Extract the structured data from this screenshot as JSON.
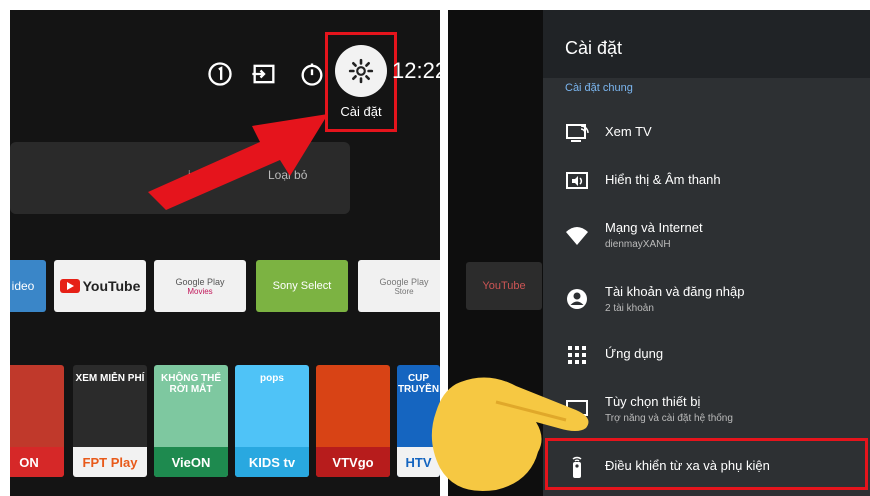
{
  "left_panel": {
    "clock": "12:22",
    "settings_label": "Cài đặt",
    "card": {
      "details_label": "i tiết",
      "remove_label": "Loại bỏ"
    },
    "apps": [
      {
        "label": "ideo",
        "bg": "#3a86c8",
        "fg": "#ffffff"
      },
      {
        "label": "YouTube",
        "bg": "#f1f1f1",
        "fg": "#222222"
      },
      {
        "label": "Google Play",
        "sub": "Movies",
        "bg": "#f1f1f1",
        "fg": "#555555"
      },
      {
        "label": "Sony Select",
        "bg": "#7cb342",
        "fg": "#ffffff"
      },
      {
        "label": "Google Play",
        "sub": "Store",
        "bg": "#f1f1f1",
        "fg": "#777777"
      }
    ],
    "tiles": [
      {
        "top_text": "",
        "bottom_text": "ON",
        "bg": "#c0392b",
        "bottom_bg": "#d62828",
        "fg": "#ffffff"
      },
      {
        "top_text": "XEM MIỄN PHÍ",
        "bottom_text": "FPT Play",
        "bg": "#2b2b2b",
        "bottom_bg": "#f2f2f2",
        "fg": "#e85a1a"
      },
      {
        "top_text": "KHÔNG THỂ RỜI MẮT",
        "bottom_text": "VieON",
        "bg": "#7ec8a0",
        "bottom_bg": "#1e8a4f",
        "fg": "#ffffff"
      },
      {
        "top_text": "pops",
        "bottom_text": "KIDS tv",
        "bg": "#4fc3f7",
        "bottom_bg": "#29a8e0",
        "fg": "#ffffff"
      },
      {
        "top_text": "",
        "bottom_text": "VTVgo",
        "bg": "#d84315",
        "bottom_bg": "#b71c1c",
        "fg": "#ffffff"
      },
      {
        "top_text": "CUP TRUYỀN",
        "bottom_text": "HTV",
        "bg": "#1565c0",
        "bottom_bg": "#f2f2f2",
        "fg": "#1565c0"
      }
    ]
  },
  "right_panel": {
    "title": "Cài đặt",
    "section": "Cài đặt chung",
    "bg_tile_label": "YouTube",
    "items": [
      {
        "icon": "tv-cast-icon",
        "title": "Xem TV",
        "subtitle": ""
      },
      {
        "icon": "display-sound-icon",
        "title": "Hiển thị & Âm thanh",
        "subtitle": ""
      },
      {
        "icon": "wifi-icon",
        "title": "Mạng và Internet",
        "subtitle": "dienmayXANH"
      },
      {
        "icon": "account-icon",
        "title": "Tài khoản và đăng nhập",
        "subtitle": "2 tài khoản"
      },
      {
        "icon": "apps-grid-icon",
        "title": "Ứng dụng",
        "subtitle": ""
      },
      {
        "icon": "device-icon",
        "title": "Tùy chọn thiết bị",
        "subtitle": "Trợ năng và cài đặt hệ thống"
      },
      {
        "icon": "remote-icon",
        "title": "Điều khiển từ xa và phụ kiện",
        "subtitle": ""
      }
    ]
  },
  "colors": {
    "highlight": "#e5141c",
    "accent_blue": "#7bb6f0",
    "panel": "#2d3033"
  }
}
